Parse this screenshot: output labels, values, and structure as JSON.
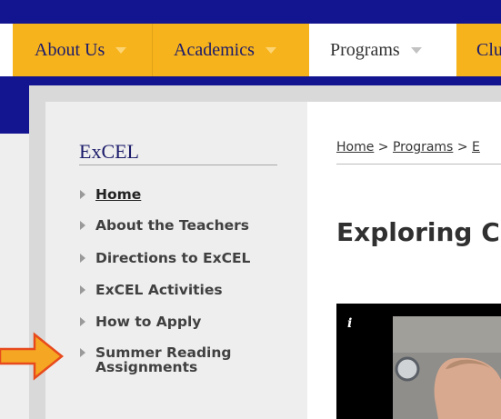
{
  "nav": {
    "items": [
      {
        "label": "About Us"
      },
      {
        "label": "Academics"
      },
      {
        "label": "Programs"
      },
      {
        "label": "Clu"
      }
    ]
  },
  "sidebar": {
    "title": "ExCEL",
    "items": [
      {
        "label": "Home"
      },
      {
        "label": "About the Teachers"
      },
      {
        "label": "Directions to ExCEL"
      },
      {
        "label": "ExCEL Activities"
      },
      {
        "label": "How to Apply"
      },
      {
        "label": "Summer Reading Assignments"
      }
    ]
  },
  "breadcrumb": {
    "home": "Home",
    "separator": ">",
    "programs": "Programs",
    "current": "E"
  },
  "main": {
    "title": "Exploring C",
    "video_info_glyph": "i"
  },
  "colors": {
    "navy": "#13148f",
    "gold": "#f6b31c",
    "arrow": "#f5a623",
    "arrow_outline": "#e84a1c"
  }
}
